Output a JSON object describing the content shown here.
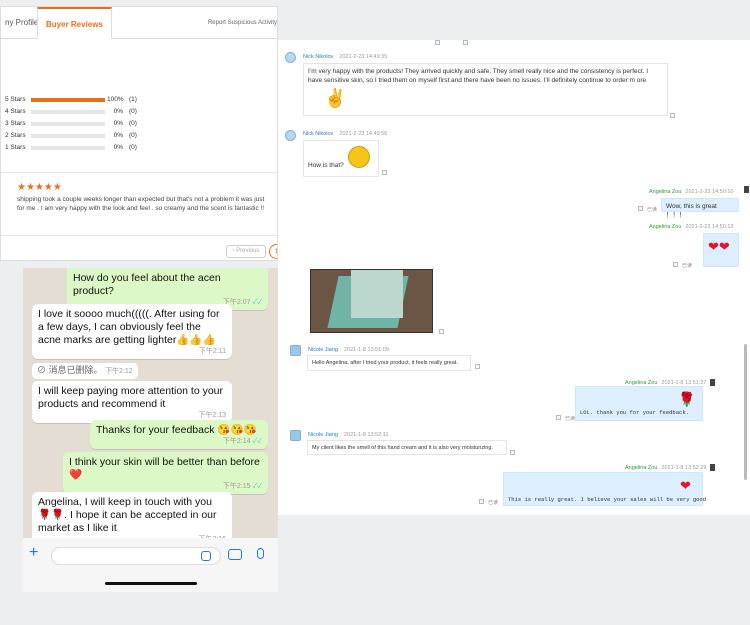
{
  "reviews": {
    "tab_profile": "ny Profile",
    "tab_reviews": "Buyer Reviews",
    "report": "Report Suspicious Activity",
    "rows": [
      {
        "label": "5 Stars",
        "fill": 1.0,
        "percent": "100%",
        "count": "(1)"
      },
      {
        "label": "4 Stars",
        "fill": 0,
        "percent": "0%",
        "count": "(0)"
      },
      {
        "label": "3 Stars",
        "fill": 0,
        "percent": "0%",
        "count": "(0)"
      },
      {
        "label": "2 Stars",
        "fill": 0,
        "percent": "0%",
        "count": "(0)"
      },
      {
        "label": "1 Stars",
        "fill": 0,
        "percent": "0%",
        "count": "(0)"
      }
    ],
    "stars": "★★★★★",
    "review_text": "shipping took a couple weeks longer than expected but that's not a problem it was just for me . I am very happy with the look and feel . so creamy and the scent is fantastic !!",
    "prev": "‹ Previous",
    "page": "1",
    "accent": "#e8701a"
  },
  "whatsapp": {
    "messages": [
      {
        "text": "How do you feel about the acen product?",
        "time": "下午2:07",
        "ticks": "✓✓"
      },
      {
        "text": "I love it soooo much(((((. After using for a few days, I can obviously feel the acne marks are getting lighter👍👍👍",
        "time": "下午2:11"
      },
      {
        "text": "消息已删除。",
        "time": "下午2:12"
      },
      {
        "text": "I will keep paying more attention to your products and recommend it",
        "time": "下午2:13"
      },
      {
        "text": "Thanks for your feedback 😘😘😘",
        "time": "下午2:14",
        "ticks": "✓✓"
      },
      {
        "text": "I think your skin will be better than before ❤️",
        "time": "下午2:15",
        "ticks": "✓✓"
      },
      {
        "text": "Angelina, I will keep in touch with you 🌹🌹. I hope it can be accepted in our market as I like it",
        "time": "下午2:16"
      }
    ],
    "deleted_icon": "⊘",
    "plus": "+",
    "colors": {
      "out": "#dcf8c6",
      "in": "#ffffff",
      "accent": "#1b7ae8",
      "wallpaper": "#e3ddd3"
    }
  },
  "chat": {
    "m1": {
      "name": "Nick Nikolov",
      "time": "2021-2-23 14:49:35",
      "text": "I’m very happy with the products! They arrived quickly and safe. They smell really nice and the consistency is perfect. I have sensitive skin, so I tried them on myself first and there have been no issues. I’ll definitely continue to order m ore",
      "emoji": "✌"
    },
    "m2": {
      "name": "Nick Nikolov",
      "time": "2021-2-23 14:49:56",
      "text": "How is that?",
      "emoji": "😲"
    },
    "m3": {
      "name": "Angelina Zou",
      "time": "2021-2-23 14:50:10",
      "text": "Wow, this is great ！！！",
      "read": "已读"
    },
    "m4": {
      "name": "Angelina Zou",
      "time": "2021-2-23 14:50:13",
      "emoji": "❤❤",
      "read": "已读"
    },
    "m5": {
      "name": "Nicole Jiang",
      "time": "2021-1-8 13:51:09",
      "text": "Hello Angelina, after I tried your product, it feels really great."
    },
    "m6": {
      "name": "Angelina Zou",
      "time": "2021-1-8 13:51:37",
      "text": "LOL. thank you for your feedback.",
      "emoji": "🌹",
      "read": "已读"
    },
    "m7": {
      "name": "Nicole Jiang",
      "time": "2021-1-8 13:52:11",
      "text": "My client likes the smell of this hand cream and it is also very moisturizing."
    },
    "m8": {
      "name": "Angelina Zou",
      "time": "2021-1-8 13:52:29",
      "text": "This is really great. I believe your sales will be very good",
      "emoji": "❤",
      "read": "已读"
    }
  }
}
